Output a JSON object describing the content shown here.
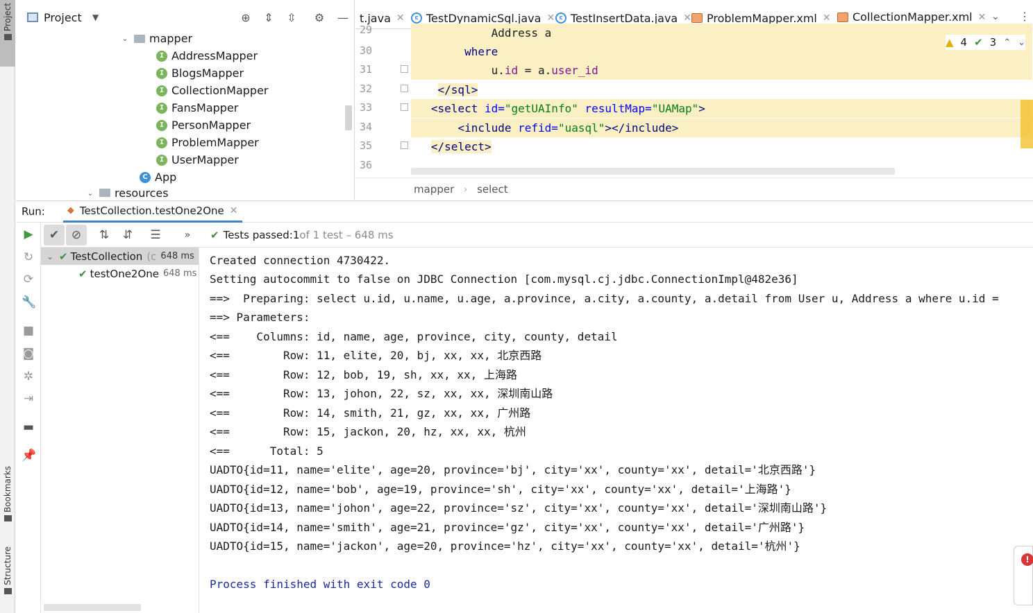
{
  "sidebar": {
    "project_tab": "Project",
    "bookmarks_tab": "Bookmarks",
    "structure_tab": "Structure"
  },
  "project_panel": {
    "title": "Project",
    "folder": "mapper",
    "items": [
      "AddressMapper",
      "BlogsMapper",
      "CollectionMapper",
      "FansMapper",
      "PersonMapper",
      "ProblemMapper",
      "UserMapper"
    ],
    "app": "App",
    "resources": "resources"
  },
  "editor": {
    "tabs": [
      {
        "label": "t.java",
        "icon": "java-icon"
      },
      {
        "label": "TestDynamicSql.java",
        "icon": "java-icon"
      },
      {
        "label": "TestInsertData.java",
        "icon": "java-icon"
      },
      {
        "label": "ProblemMapper.xml",
        "icon": "xml-icon"
      },
      {
        "label": "CollectionMapper.xml",
        "icon": "xml-icon",
        "active": true
      }
    ],
    "line_numbers": [
      "29",
      "30",
      "31",
      "32",
      "33",
      "34",
      "35",
      "36"
    ],
    "code": {
      "l29": "Address a",
      "l30_kw": "where",
      "l31_a": "u.",
      "l31_b": "id",
      "l31_c": " = a.",
      "l31_d": "user_id",
      "l32": "</sql>",
      "l33_open": "<select ",
      "l33_attr1": "id=",
      "l33_val1": "\"getUAInfo\"",
      "l33_attr2": " resultMap=",
      "l33_val2": "\"UAMap\"",
      "l33_close": ">",
      "l34_open": "<include ",
      "l34_attr": "refid=",
      "l34_val": "\"uasql\"",
      "l34_close": "></include>",
      "l35": "</select>"
    },
    "warnings": "4",
    "checks": "3",
    "breadcrumb": [
      "mapper",
      "select"
    ]
  },
  "run": {
    "label": "Run:",
    "tab": "TestCollection.testOne2One",
    "status_prefix": "Tests passed: ",
    "status_count": "1",
    "status_suffix": " of 1 test – 648 ms",
    "tree": [
      {
        "name": "TestCollection",
        "extra": "(c",
        "time": "648 ms"
      },
      {
        "name": "testOne2One",
        "time": "648 ms"
      }
    ],
    "console": [
      "Created connection 4730422.",
      "Setting autocommit to false on JDBC Connection [com.mysql.cj.jdbc.ConnectionImpl@482e36]",
      "==>  Preparing: select u.id, u.name, u.age, a.province, a.city, a.county, a.detail from User u, Address a where u.id =",
      "==> Parameters: ",
      "<==    Columns: id, name, age, province, city, county, detail",
      "<==        Row: 11, elite, 20, bj, xx, xx, 北京西路",
      "<==        Row: 12, bob, 19, sh, xx, xx, 上海路",
      "<==        Row: 13, johon, 22, sz, xx, xx, 深圳南山路",
      "<==        Row: 14, smith, 21, gz, xx, xx, 广州路",
      "<==        Row: 15, jackon, 20, hz, xx, xx, 杭州",
      "<==      Total: 5",
      "UADTO{id=11, name='elite', age=20, province='bj', city='xx', county='xx', detail='北京西路'}",
      "UADTO{id=12, name='bob', age=19, province='sh', city='xx', county='xx', detail='上海路'}",
      "UADTO{id=13, name='johon', age=22, province='sz', city='xx', county='xx', detail='深圳南山路'}",
      "UADTO{id=14, name='smith', age=21, province='gz', city='xx', county='xx', detail='广州路'}",
      "UADTO{id=15, name='jackon', age=20, province='hz', city='xx', county='xx', detail='杭州'}",
      "",
      "Process finished with exit code 0"
    ]
  },
  "colors": {
    "accent": "#4083c9",
    "pass_green": "#3f9a3f",
    "highlight": "#faf0c4",
    "xml_tag": "#000080",
    "xml_attr": "#0000ff",
    "xml_string": "#067d17",
    "process_blue": "#1a2a9e"
  }
}
